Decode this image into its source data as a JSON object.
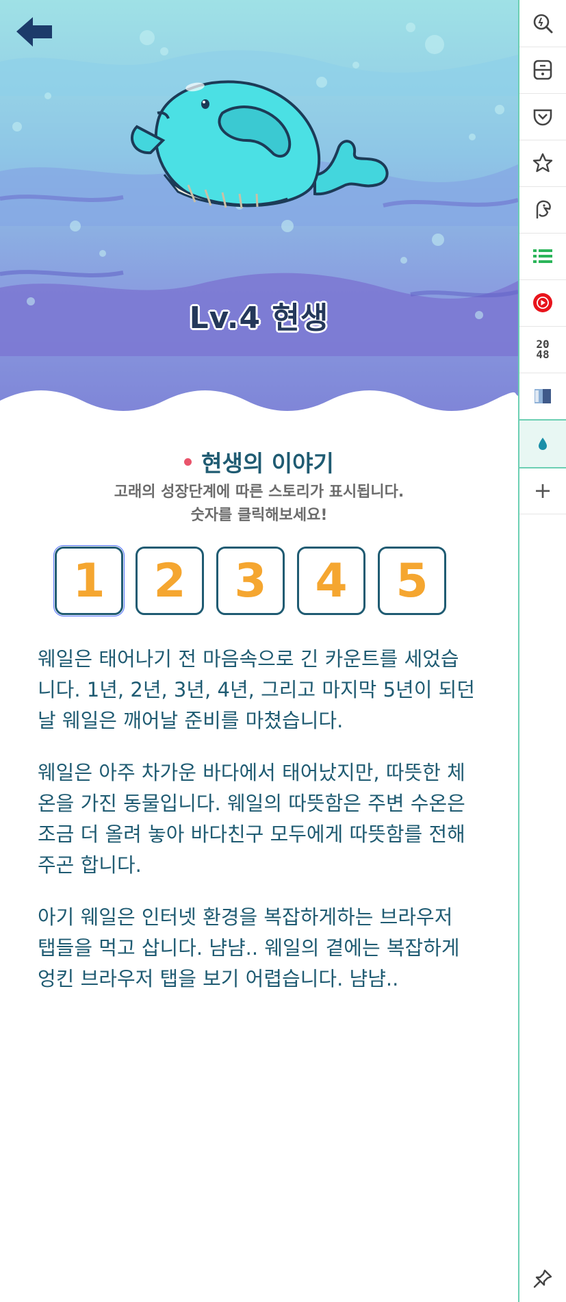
{
  "hero": {
    "level_title": "Lv.4 현생"
  },
  "story": {
    "title": "현생의 이야기",
    "subtitle_line1": "고래의 성장단계에 따른 스토리가 표시됩니다.",
    "subtitle_line2": "숫자를 클릭해보세요!",
    "numbers": [
      "1",
      "2",
      "3",
      "4",
      "5"
    ],
    "active_number": "1",
    "paragraphs": [
      "웨일은 태어나기 전 마음속으로 긴 카운트를 세었습니다. 1년, 2년, 3년, 4년, 그리고 마지막 5년이 되던 날 웨일은 깨어날 준비를 마쳤습니다.",
      "웨일은 아주 차가운 바다에서 태어났지만, 따뜻한 체온을 가진 동물입니다. 웨일의 따뜻함은 주변 수온은 조금 더 올려 놓아 바다친구 모두에게 따뜻함를 전해주곤 합니다.",
      "아기 웨일은 인터넷 환경을 복잡하게하는 브라우저 탭들을 먹고 삽니다. 냠냠.. 웨일의 곁에는 복잡하게 엉킨 브라우저 탭을 보기 어렵습니다. 냠냠.."
    ]
  },
  "sidebar": {
    "items": [
      {
        "icon": "zoom-search-icon"
      },
      {
        "icon": "calculator-icon"
      },
      {
        "icon": "pocket-icon"
      },
      {
        "icon": "star-icon"
      },
      {
        "icon": "papago-icon"
      },
      {
        "icon": "list-icon"
      },
      {
        "icon": "youtube-music-icon"
      },
      {
        "icon": "game-2048-icon",
        "text": "20\n48"
      },
      {
        "icon": "book-icon"
      },
      {
        "icon": "water-drop-icon",
        "active": true
      },
      {
        "icon": "plus-icon"
      }
    ],
    "game_2048_top": "20",
    "game_2048_bottom": "48",
    "pin_icon": "pin-icon"
  },
  "colors": {
    "accent": "#1f5b72",
    "number": "#f5a630",
    "sidebar_border": "#6ccfb3",
    "dot": "#e9546b"
  }
}
